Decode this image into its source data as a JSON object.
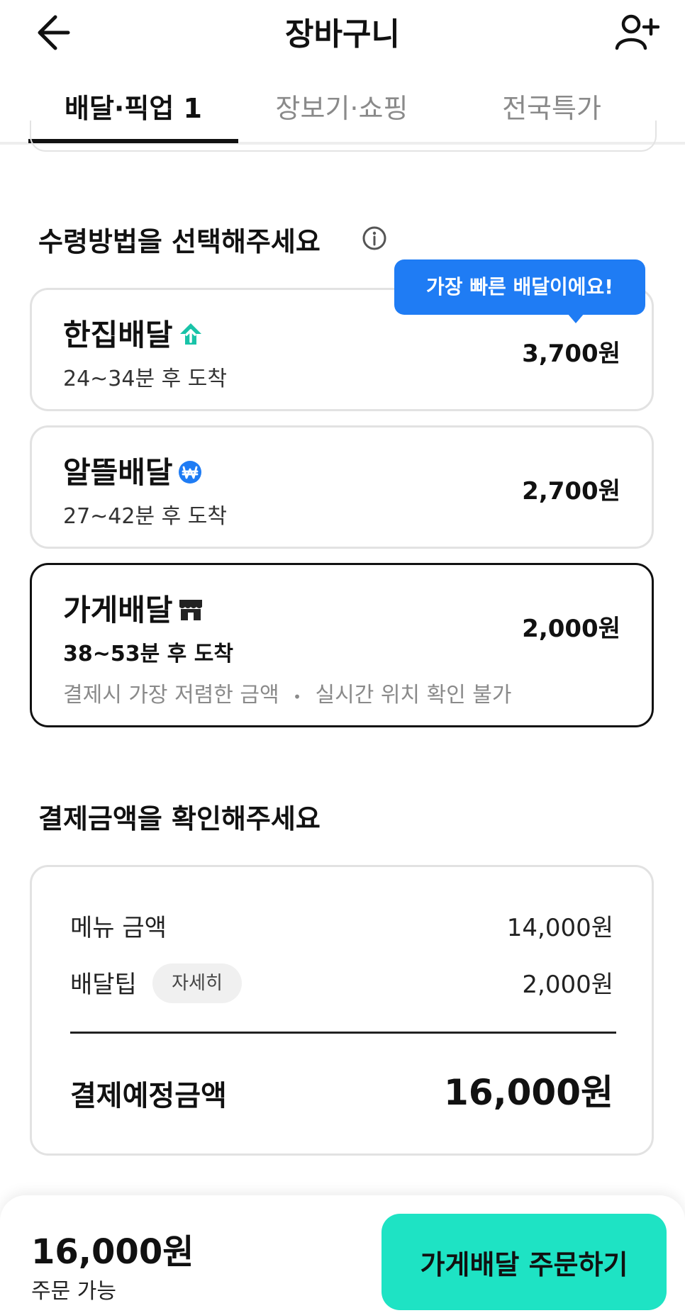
{
  "header": {
    "title": "장바구니"
  },
  "tabs": [
    {
      "label": "배달·픽업 1"
    },
    {
      "label": "장보기·쇼핑"
    },
    {
      "label": "전국특가"
    }
  ],
  "receive": {
    "title": "수령방법을 선택해주세요",
    "tooltip": "가장 빠른 배달이에요!",
    "options": [
      {
        "name": "한집배달",
        "time": "24~34분 후 도착",
        "price": "3,700원",
        "icon": "house-up-icon"
      },
      {
        "name": "알뜰배달",
        "time": "27~42분 후 도착",
        "price": "2,700원",
        "icon": "won-coin-icon"
      },
      {
        "name": "가게배달",
        "time": "38~53분 후 도착",
        "price": "2,000원",
        "icon": "store-icon",
        "note_left": "결제시 가장 저렴한 금액",
        "note_sep": "•",
        "note_right": "실시간 위치 확인 불가"
      }
    ]
  },
  "payment": {
    "title": "결제금액을 확인해주세요",
    "menu_label": "메뉴 금액",
    "menu_value": "14,000원",
    "tip_label": "배달팁",
    "tip_detail": "자세히",
    "tip_value": "2,000원",
    "total_label": "결제예정금액",
    "total_value": "16,000원"
  },
  "bottom": {
    "price": "16,000원",
    "status": "주문 가능",
    "order_label": "가게배달 주문하기"
  },
  "colors": {
    "accent": "#1ee3c4",
    "tooltip": "#1f7cf4",
    "teal_icon": "#19c3a8"
  }
}
